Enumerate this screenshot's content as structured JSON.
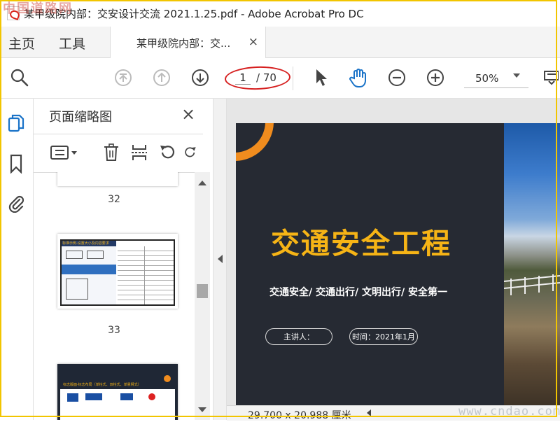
{
  "window": {
    "title": "某甲级院内部：交安设计交流 2021.1.25.pdf - Adobe Acrobat Pro DC"
  },
  "menu": {
    "home": "主页",
    "tools": "工具"
  },
  "tab": {
    "label": "某甲级院内部：交...",
    "close": "×"
  },
  "toolbar": {
    "page_current": "1",
    "page_total": "/ 70",
    "zoom": "50%",
    "icons": [
      "search-zoom-icon",
      "first-page-icon",
      "prev-page-icon",
      "next-page-icon",
      "select-arrow-icon",
      "hand-tool-icon",
      "zoom-out-icon",
      "zoom-in-icon",
      "page-display-icon"
    ]
  },
  "rail": {
    "icons": [
      "page-thumbnails-icon",
      "bookmarks-icon",
      "attachments-icon"
    ]
  },
  "thumbnails_panel": {
    "title": "页面缩略图",
    "close": "×",
    "tools": [
      "options-menu-icon",
      "delete-icon",
      "insert-page-icon",
      "undo-icon",
      "redo-icon"
    ],
    "pages": [
      {
        "label": "32"
      },
      {
        "label": "33",
        "heading": "标准示例-设置大小及内容要求"
      },
      {
        "label": "",
        "heading": "标志版面·标志布局（单柱式、双柱式、单悬臂式）"
      }
    ]
  },
  "slide": {
    "title": "交通安全工程",
    "subtitle": "交通安全/ 交通出行/ 文明出行/ 安全第一",
    "speaker": "主讲人：",
    "time": "时间：2021年1月",
    "accent_color": "#f08c1e",
    "title_color": "#f6b416",
    "background_color": "#262a33"
  },
  "statusbar": {
    "dimensions": "29.700 x 20.988 厘米"
  },
  "watermarks": {
    "top_left": "中国道路网",
    "bottom_right": "www.cndao.com"
  }
}
